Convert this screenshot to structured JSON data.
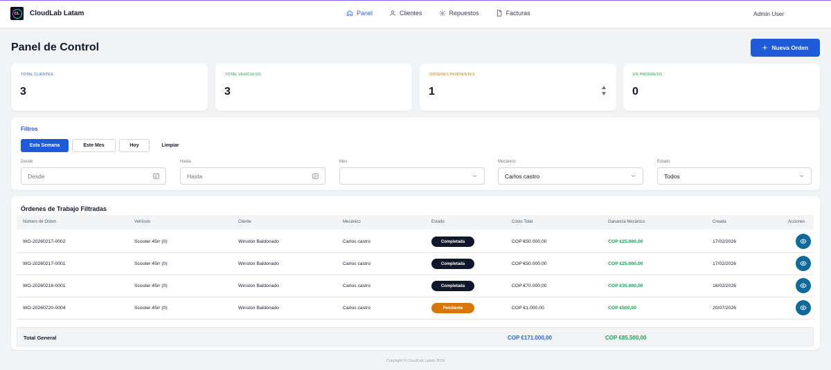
{
  "app": {
    "brand": "CloudLab Latam",
    "logo_text": "CL"
  },
  "nav": {
    "items": [
      {
        "label": "Panel",
        "icon": "home-icon",
        "active": true
      },
      {
        "label": "Clientes",
        "icon": "user-icon",
        "active": false
      },
      {
        "label": "Repuestos",
        "icon": "gear-icon",
        "active": false
      },
      {
        "label": "Facturas",
        "icon": "document-icon",
        "active": false
      }
    ],
    "user": "Admin User"
  },
  "header": {
    "title": "Panel de Control",
    "new_order_label": "Nueva Orden"
  },
  "stats": [
    {
      "label": "TOTAL CLIENTES",
      "value": "3",
      "color": "#2563eb"
    },
    {
      "label": "TOTAL VEHÍCULOS",
      "value": "3",
      "color": "#16a34a"
    },
    {
      "label": "ÓRDENES PENDIENTES",
      "value": "1",
      "color": "#d97706"
    },
    {
      "label": "EN PROGRESO",
      "value": "0",
      "color": "#16a34a"
    }
  ],
  "filters": {
    "title": "Filtros",
    "quick": {
      "this_week": "Esta Semana",
      "this_month": "Este Mes",
      "today": "Hoy",
      "clear": "Limpiar"
    },
    "desde": {
      "label": "Desde",
      "placeholder": "Desde"
    },
    "hasta": {
      "label": "Hasta",
      "placeholder": "Hasta"
    },
    "mes": {
      "label": "Mes",
      "value": ""
    },
    "mecanico": {
      "label": "Mecánico",
      "value": "Carlos castro"
    },
    "estado": {
      "label": "Estado",
      "value": "Todos"
    }
  },
  "orders": {
    "title": "Órdenes de Trabajo Filtradas",
    "columns": {
      "number": "Número de Orden",
      "vehicle": "Vehículo",
      "client": "Cliente",
      "mechanic": "Mecánico",
      "status": "Estado",
      "total_cost": "Costo Total",
      "mechanic_profit": "Ganancia Mecánico",
      "created": "Creada",
      "actions": "Acciones"
    },
    "rows": [
      {
        "number": "WO-20260217-0002",
        "vehicle": "Scooter 45rr (0)",
        "client": "Winston Baldonado",
        "mechanic": "Carlos castro",
        "status": "Completada",
        "total_cost": "COP €50.000,00",
        "mechanic_profit": "COP €25.000,00",
        "created": "17/02/2026"
      },
      {
        "number": "WO-20260217-0001",
        "vehicle": "Scooter 45rr (0)",
        "client": "Winston Baldonado",
        "mechanic": "Carlos castro",
        "status": "Completada",
        "total_cost": "COP €50.000,00",
        "mechanic_profit": "COP €25.000,00",
        "created": "17/02/2026"
      },
      {
        "number": "WO-20260216-0001",
        "vehicle": "Scooter 45rr (0)",
        "client": "Winston Baldonado",
        "mechanic": "Carlos castro",
        "status": "Completada",
        "total_cost": "COP €70.000,00",
        "mechanic_profit": "COP €35.000,00",
        "created": "16/02/2026"
      },
      {
        "number": "WO-20260720-0004",
        "vehicle": "Scooter 45rr (0)",
        "client": "Winston Baldonado",
        "mechanic": "Carlos castro",
        "status": "Pendiente",
        "total_cost": "COP €1.000,00",
        "mechanic_profit": "COP €500,00",
        "created": "20/07/2026"
      }
    ],
    "total": {
      "label": "Total General",
      "cost": "COP €171.000,00",
      "profit": "COP €85.500,00"
    }
  },
  "footer": {
    "copyright": "Copyright © CloudLab Latam 2026"
  }
}
